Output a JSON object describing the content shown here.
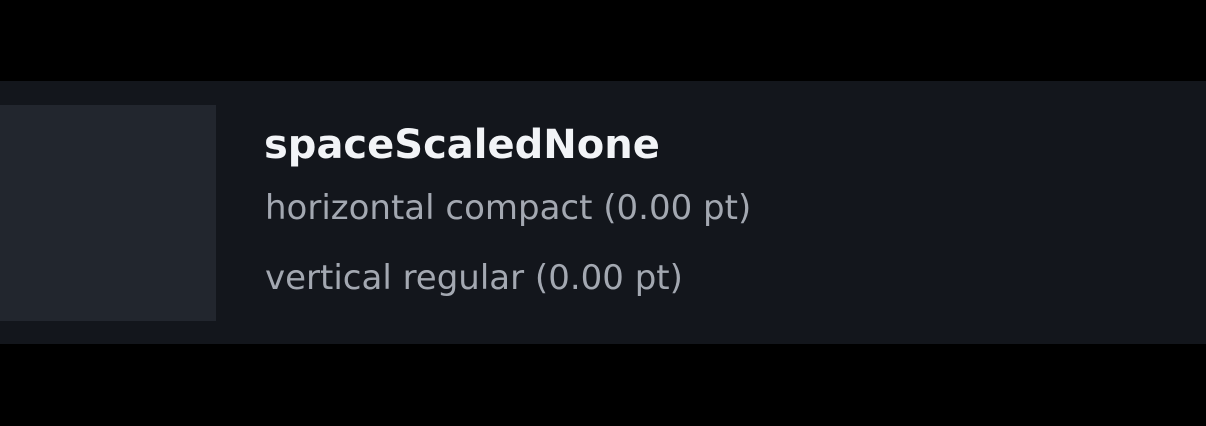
{
  "token": {
    "name": "spaceScaledNone",
    "horizontal": "horizontal compact (0.00 pt)",
    "vertical": "vertical regular (0.00 pt)"
  },
  "colors": {
    "page_background": "#000000",
    "row_background": "#13161c",
    "swatch": "#22262e",
    "title_text": "#f2f4f7",
    "detail_text": "#a3a8b1"
  }
}
